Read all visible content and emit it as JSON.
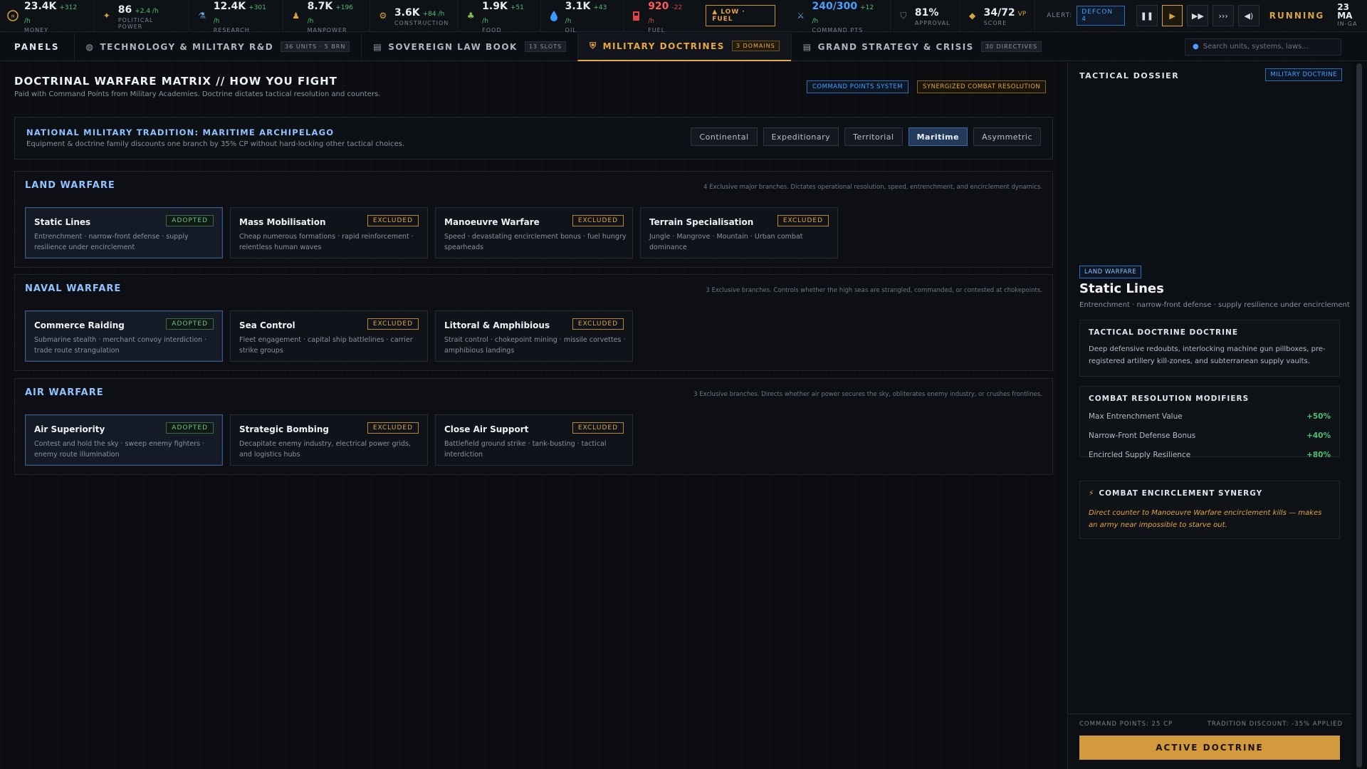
{
  "resources": [
    {
      "icon": "money-icon",
      "value": "23.4K",
      "rate": "+312 /h",
      "label": "MONEY"
    },
    {
      "icon": "political-power-icon",
      "value": "86",
      "rate": "+2.4 /h",
      "label": "POLITICAL POWER"
    },
    {
      "icon": "research-icon",
      "value": "12.4K",
      "rate": "+301 /h",
      "label": "RESEARCH"
    },
    {
      "icon": "manpower-icon",
      "value": "8.7K",
      "rate": "+196 /h",
      "label": "MANPOWER"
    },
    {
      "icon": "construction-icon",
      "value": "3.6K",
      "rate": "+84 /h",
      "label": "CONSTRUCTION"
    },
    {
      "icon": "food-icon",
      "value": "1.9K",
      "rate": "+51 /h",
      "label": "FOOD"
    },
    {
      "icon": "oil-icon",
      "value": "3.1K",
      "rate": "+43 /h",
      "label": "OIL"
    },
    {
      "icon": "fuel-icon",
      "value": "920",
      "rate": "-22 /h",
      "label": "FUEL"
    }
  ],
  "fuel_warning": "▲ LOW · FUEL",
  "resources2": [
    {
      "icon": "command-points-icon",
      "value": "240/300",
      "rate": "+12 /h",
      "label": "COMMAND PTS"
    },
    {
      "icon": "approval-icon",
      "value": "81%",
      "rate": "",
      "label": "APPROVAL"
    },
    {
      "icon": "score-icon",
      "value": "34/72",
      "rate": "VP",
      "label": "SCORE"
    }
  ],
  "alert": {
    "label": "ALERT:",
    "value": "DEFCON 4"
  },
  "status": "RUNNING",
  "clock": {
    "date": "23 MA",
    "sub": "IN-GA"
  },
  "tabs": {
    "panels_label": "PANELS",
    "items": [
      {
        "label": "TECHNOLOGY & MILITARY R&D",
        "count": "36 UNITS · 5 BRN"
      },
      {
        "label": "SOVEREIGN LAW BOOK",
        "count": "13 SLOTS"
      },
      {
        "label": "MILITARY DOCTRINES",
        "count": "3 DOMAINS"
      },
      {
        "label": "GRAND STRATEGY & CRISIS",
        "count": "30 DIRECTIVES"
      }
    ],
    "search_placeholder": "Search units, systems, laws..."
  },
  "main": {
    "title": "DOCTRINAL WARFARE MATRIX // HOW YOU FIGHT",
    "subtitle": "Paid with Command Points from Military Academies. Doctrine dictates tactical resolution and counters.",
    "chip_a": "COMMAND POINTS SYSTEM",
    "chip_b": "SYNERGIZED COMBAT RESOLUTION",
    "tradition": {
      "title": "NATIONAL MILITARY TRADITION: MARITIME ARCHIPELAGO",
      "desc": "Equipment & doctrine family discounts one branch by 35% CP without hard-locking other tactical choices.",
      "options": [
        "Continental",
        "Expeditionary",
        "Territorial",
        "Maritime",
        "Asymmetric"
      ],
      "selected": "Maritime"
    },
    "sections": [
      {
        "title": "LAND WARFARE",
        "desc": "4 Exclusive major branches. Dictates operational resolution, speed, entrenchment, and encirclement dynamics.",
        "cards": [
          {
            "name": "Static Lines",
            "status": "ADOPTED",
            "desc": "Entrenchment · narrow-front defense · supply resilience under encirclement"
          },
          {
            "name": "Mass Mobilisation",
            "status": "EXCLUDED",
            "desc": "Cheap numerous formations · rapid reinforcement · relentless human waves"
          },
          {
            "name": "Manoeuvre Warfare",
            "status": "EXCLUDED",
            "desc": "Speed · devastating encirclement bonus · fuel hungry spearheads"
          },
          {
            "name": "Terrain Specialisation",
            "status": "EXCLUDED",
            "desc": "Jungle · Mangrove · Mountain · Urban combat dominance"
          }
        ]
      },
      {
        "title": "NAVAL WARFARE",
        "desc": "3 Exclusive branches. Controls whether the high seas are strangled, commanded, or contested at chokepoints.",
        "cards": [
          {
            "name": "Commerce Raiding",
            "status": "ADOPTED",
            "desc": "Submarine stealth · merchant convoy interdiction · trade route strangulation"
          },
          {
            "name": "Sea Control",
            "status": "EXCLUDED",
            "desc": "Fleet engagement · capital ship battlelines · carrier strike groups"
          },
          {
            "name": "Littoral & Amphibious",
            "status": "EXCLUDED",
            "desc": "Strait control · chokepoint mining · missile corvettes · amphibious landings"
          }
        ]
      },
      {
        "title": "AIR WARFARE",
        "desc": "3 Exclusive branches. Directs whether air power secures the sky, obliterates enemy industry, or crushes frontlines.",
        "cards": [
          {
            "name": "Air Superiority",
            "status": "ADOPTED",
            "desc": "Contest and hold the sky · sweep enemy fighters · enemy route illumination"
          },
          {
            "name": "Strategic Bombing",
            "status": "EXCLUDED",
            "desc": "Decapitate enemy industry, electrical power grids, and logistics hubs"
          },
          {
            "name": "Close Air Support",
            "status": "EXCLUDED",
            "desc": "Battlefield ground strike · tank-busting · tactical interdiction"
          }
        ]
      }
    ]
  },
  "side": {
    "title": "TACTICAL DOSSIER",
    "chip": "MILITARY DOCTRINE",
    "domain": "LAND WARFARE",
    "name": "Static Lines",
    "desc": "Entrenchment · narrow-front defense · supply resilience under encirclement",
    "doctrine_heading": "TACTICAL DOCTRINE DOCTRINE",
    "doctrine_text": "Deep defensive redoubts, interlocking machine gun pillboxes, pre-registered artillery kill-zones, and subterranean supply vaults.",
    "mods_heading": "COMBAT RESOLUTION MODIFIERS",
    "mods": [
      {
        "label": "Max Entrenchment Value",
        "value": "+50%"
      },
      {
        "label": "Narrow-Front Defense Bonus",
        "value": "+40%"
      },
      {
        "label": "Encircled Supply Resilience",
        "value": "+80%"
      }
    ],
    "synergy_heading": "COMBAT ENCIRCLEMENT SYNERGY",
    "synergy_text": "Direct counter to Manoeuvre Warfare encirclement kills — makes an army near impossible to starve out.",
    "footer_left": "COMMAND POINTS: 25 CP",
    "footer_right": "TRADITION DISCOUNT: -35% APPLIED",
    "button": "ACTIVE DOCTRINE"
  }
}
